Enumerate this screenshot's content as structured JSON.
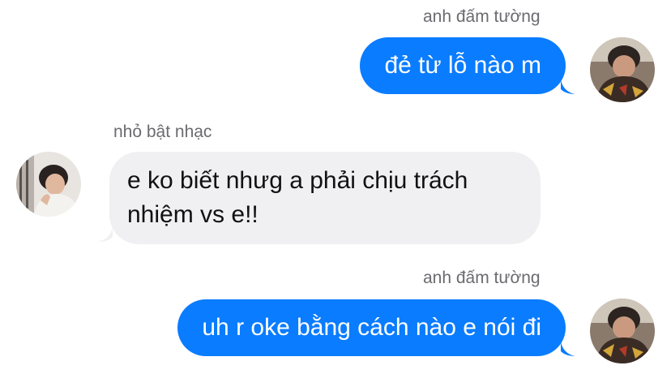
{
  "colors": {
    "outgoing_bubble": "#0a7cff",
    "incoming_bubble": "#f0f0f2",
    "sender_name": "#6b6b70"
  },
  "messages": [
    {
      "direction": "outgoing",
      "sender": "anh đấm tường",
      "text": "đẻ từ lỗ nào m",
      "avatar_icon": "user-avatar-icon"
    },
    {
      "direction": "incoming",
      "sender": "nhỏ bật nhạc",
      "text": "e ko biết nhưg a phải chịu trách nhiệm vs e!!",
      "avatar_icon": "user-avatar-icon"
    },
    {
      "direction": "outgoing",
      "sender": "anh đấm tường",
      "text": "uh r oke bằng cách nào e nói đi",
      "avatar_icon": "user-avatar-icon"
    }
  ]
}
